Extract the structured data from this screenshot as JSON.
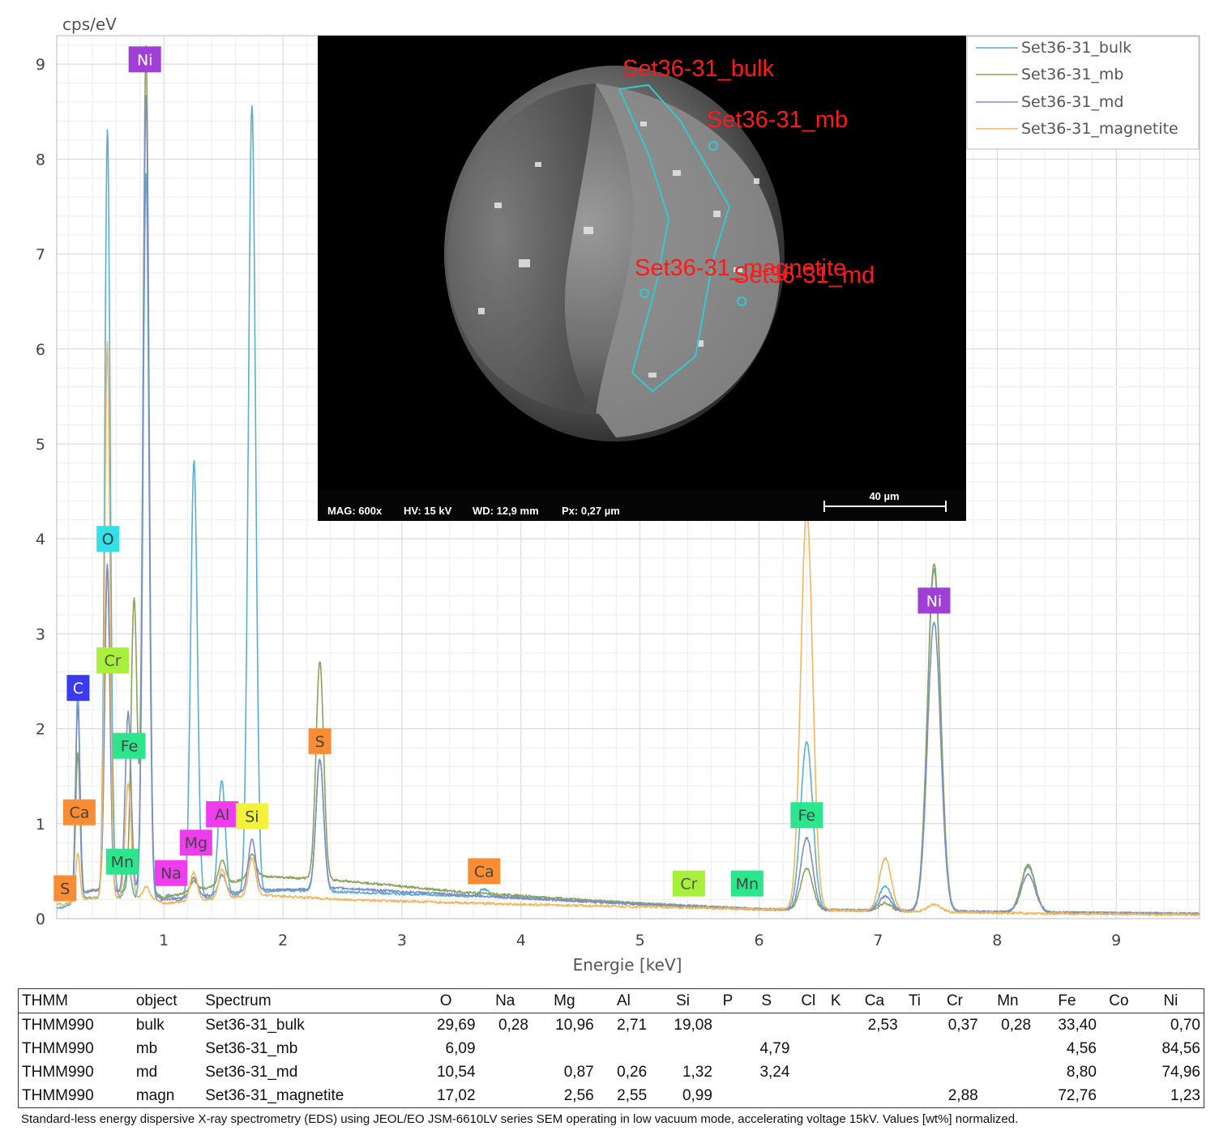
{
  "chart_data": {
    "type": "line",
    "ylabel": "cps/eV",
    "xlabel": "Energie [keV]",
    "xlim": [
      0.1,
      9.7
    ],
    "ylim": [
      0,
      9.3
    ],
    "xticks": [
      1,
      2,
      3,
      4,
      5,
      6,
      7,
      8,
      9
    ],
    "yticks": [
      0,
      1,
      2,
      3,
      4,
      5,
      6,
      7,
      8,
      9
    ],
    "grid": true,
    "legend_position": "top-right",
    "series": [
      {
        "name": "Set36-31_bulk",
        "color": "#5aaed2",
        "baseline": 0.12,
        "continuum": [
          [
            0.15,
            0.12
          ],
          [
            0.35,
            0.22
          ],
          [
            0.9,
            0.2
          ],
          [
            1.0,
            0.17
          ],
          [
            2.0,
            0.3
          ],
          [
            2.5,
            0.28
          ],
          [
            4.0,
            0.22
          ],
          [
            5.0,
            0.16
          ],
          [
            6.0,
            0.1
          ],
          [
            8.0,
            0.07
          ],
          [
            9.7,
            0.05
          ]
        ],
        "peaks": [
          [
            0.277,
            2.2,
            0.018
          ],
          [
            0.525,
            7.88,
            0.022
          ],
          [
            0.56,
            0.6,
            0.025
          ],
          [
            0.7,
            0.35,
            0.025
          ],
          [
            0.85,
            7.65,
            0.025
          ],
          [
            1.04,
            0.08,
            0.03
          ],
          [
            1.253,
            4.62,
            0.028
          ],
          [
            1.486,
            1.22,
            0.03
          ],
          [
            1.74,
            8.3,
            0.03
          ],
          [
            2.31,
            1.4,
            0.032
          ],
          [
            3.69,
            0.08,
            0.04
          ],
          [
            6.4,
            1.77,
            0.05
          ],
          [
            7.06,
            0.26,
            0.05
          ],
          [
            7.47,
            3.6,
            0.055
          ],
          [
            8.26,
            0.48,
            0.058
          ]
        ]
      },
      {
        "name": "Set36-31_mb",
        "color": "#8aa35a",
        "baseline": 0.2,
        "continuum": [
          [
            0.15,
            0.2
          ],
          [
            0.4,
            0.3
          ],
          [
            0.9,
            0.28
          ],
          [
            1.0,
            0.22
          ],
          [
            1.8,
            0.45
          ],
          [
            2.5,
            0.4
          ],
          [
            3.5,
            0.28
          ],
          [
            5.0,
            0.16
          ],
          [
            6.0,
            0.1
          ],
          [
            8.0,
            0.07
          ],
          [
            9.7,
            0.05
          ]
        ],
        "peaks": [
          [
            0.277,
            1.5,
            0.018
          ],
          [
            0.525,
            3.4,
            0.022
          ],
          [
            0.75,
            3.1,
            0.025
          ],
          [
            0.85,
            8.9,
            0.025
          ],
          [
            1.25,
            0.1,
            0.03
          ],
          [
            1.49,
            0.25,
            0.03
          ],
          [
            1.74,
            0.25,
            0.03
          ],
          [
            2.31,
            2.3,
            0.032
          ],
          [
            6.4,
            0.43,
            0.05
          ],
          [
            7.06,
            0.08,
            0.05
          ],
          [
            7.47,
            3.67,
            0.055
          ],
          [
            8.26,
            0.5,
            0.058
          ]
        ]
      },
      {
        "name": "Set36-31_md",
        "color": "#7d8ec7",
        "baseline": 0.2,
        "continuum": [
          [
            0.15,
            0.2
          ],
          [
            0.4,
            0.3
          ],
          [
            0.9,
            0.26
          ],
          [
            1.0,
            0.2
          ],
          [
            1.8,
            0.3
          ],
          [
            2.5,
            0.32
          ],
          [
            3.5,
            0.25
          ],
          [
            5.0,
            0.15
          ],
          [
            6.0,
            0.1
          ],
          [
            8.0,
            0.07
          ],
          [
            9.7,
            0.05
          ]
        ],
        "peaks": [
          [
            0.277,
            2.0,
            0.018
          ],
          [
            0.525,
            3.45,
            0.022
          ],
          [
            0.7,
            1.9,
            0.025
          ],
          [
            0.85,
            8.4,
            0.025
          ],
          [
            1.25,
            0.2,
            0.03
          ],
          [
            1.49,
            0.2,
            0.03
          ],
          [
            1.74,
            0.55,
            0.03
          ],
          [
            2.31,
            1.36,
            0.032
          ],
          [
            6.4,
            0.76,
            0.05
          ],
          [
            7.06,
            0.15,
            0.05
          ],
          [
            7.47,
            3.05,
            0.055
          ],
          [
            8.26,
            0.4,
            0.058
          ]
        ]
      },
      {
        "name": "Set36-31_magnetite",
        "color": "#f2b65e",
        "baseline": 0.15,
        "continuum": [
          [
            0.15,
            0.15
          ],
          [
            0.4,
            0.22
          ],
          [
            0.9,
            0.22
          ],
          [
            1.0,
            0.16
          ],
          [
            1.8,
            0.25
          ],
          [
            2.5,
            0.2
          ],
          [
            4.0,
            0.15
          ],
          [
            6.0,
            0.1
          ],
          [
            8.0,
            0.06
          ],
          [
            9.7,
            0.04
          ]
        ],
        "peaks": [
          [
            0.277,
            0.5,
            0.018
          ],
          [
            0.525,
            5.85,
            0.022
          ],
          [
            0.7,
            1.2,
            0.025
          ],
          [
            0.85,
            0.12,
            0.025
          ],
          [
            1.25,
            0.3,
            0.03
          ],
          [
            1.49,
            0.3,
            0.03
          ],
          [
            1.74,
            0.4,
            0.03
          ],
          [
            6.4,
            4.2,
            0.05
          ],
          [
            7.06,
            0.56,
            0.05
          ],
          [
            7.47,
            0.08,
            0.055
          ]
        ]
      }
    ],
    "element_labels": [
      {
        "text": "Ni",
        "x": 0.84,
        "y": 9.05,
        "color": "#a03fd6",
        "fg": "#ffffff"
      },
      {
        "text": "O",
        "x": 0.53,
        "y": 4.0,
        "color": "#33e0e6",
        "fg": "#333333"
      },
      {
        "text": "Cr",
        "x": 0.57,
        "y": 2.72,
        "color": "#a9f03c",
        "fg": "#555555"
      },
      {
        "text": "C",
        "x": 0.28,
        "y": 2.43,
        "color": "#3a3aee",
        "fg": "#ffffff"
      },
      {
        "text": "Fe",
        "x": 0.71,
        "y": 1.82,
        "color": "#2ce68e",
        "fg": "#444444"
      },
      {
        "text": "Ca",
        "x": 0.29,
        "y": 1.12,
        "color": "#fa8c34",
        "fg": "#444444"
      },
      {
        "text": "Mn",
        "x": 0.65,
        "y": 0.6,
        "color": "#2ce68e",
        "fg": "#444444"
      },
      {
        "text": "Na",
        "x": 1.06,
        "y": 0.48,
        "color": "#ee3cee",
        "fg": "#444444"
      },
      {
        "text": "Mg",
        "x": 1.27,
        "y": 0.8,
        "color": "#ee3cee",
        "fg": "#444444"
      },
      {
        "text": "Al",
        "x": 1.49,
        "y": 1.1,
        "color": "#ee3cee",
        "fg": "#444444"
      },
      {
        "text": "Si",
        "x": 1.74,
        "y": 1.08,
        "color": "#f2f23a",
        "fg": "#444444"
      },
      {
        "text": "S",
        "x": 0.17,
        "y": 0.32,
        "color": "#fa8c34",
        "fg": "#444444"
      },
      {
        "text": "S",
        "x": 2.31,
        "y": 1.87,
        "color": "#fa8c34",
        "fg": "#444444"
      },
      {
        "text": "Ca",
        "x": 3.69,
        "y": 0.5,
        "color": "#fa8c34",
        "fg": "#444444"
      },
      {
        "text": "Cr",
        "x": 5.41,
        "y": 0.37,
        "color": "#a9f03c",
        "fg": "#555555"
      },
      {
        "text": "Mn",
        "x": 5.9,
        "y": 0.37,
        "color": "#2ce68e",
        "fg": "#444444"
      },
      {
        "text": "Fe",
        "x": 6.4,
        "y": 1.09,
        "color": "#2ce68e",
        "fg": "#444444"
      },
      {
        "text": "Ni",
        "x": 7.47,
        "y": 3.35,
        "color": "#a03fd6",
        "fg": "#ffffff"
      }
    ]
  },
  "sem_image": {
    "spot_labels": [
      "Set36-31_bulk",
      "Set36-31_mb",
      "Set36-31_magnetite",
      "Set36-31_md"
    ],
    "info": {
      "mag": "MAG: 600x",
      "hv": "HV: 15 kV",
      "wd": "WD: 12,9 mm",
      "px": "Px: 0,27 µm"
    },
    "scale_bar": "40 µm"
  },
  "table": {
    "headers": [
      "THMM",
      "object",
      "Spectrum",
      "O",
      "Na",
      "Mg",
      "Al",
      "Si",
      "P",
      "S",
      "Cl",
      "K",
      "Ca",
      "Ti",
      "Cr",
      "Mn",
      "Fe",
      "Co",
      "Ni"
    ],
    "rows": [
      [
        "THMM990",
        "bulk",
        "Set36-31_bulk",
        "29,69",
        "0,28",
        "10,96",
        "2,71",
        "19,08",
        "",
        "",
        "",
        "",
        "2,53",
        "",
        "0,37",
        "0,28",
        "33,40",
        "",
        "0,70"
      ],
      [
        "THMM990",
        "mb",
        "Set36-31_mb",
        "6,09",
        "",
        "",
        "",
        "",
        "",
        "4,79",
        "",
        "",
        "",
        "",
        "",
        "",
        "4,56",
        "",
        "84,56"
      ],
      [
        "THMM990",
        "md",
        "Set36-31_md",
        "10,54",
        "",
        "0,87",
        "0,26",
        "1,32",
        "",
        "3,24",
        "",
        "",
        "",
        "",
        "",
        "",
        "8,80",
        "",
        "74,96"
      ],
      [
        "THMM990",
        "magn",
        "Set36-31_magnetite",
        "17,02",
        "",
        "2,56",
        "2,55",
        "0,99",
        "",
        "",
        "",
        "",
        "",
        "",
        "2,88",
        "",
        "72,76",
        "",
        "1,23"
      ]
    ]
  },
  "footnote": "Standard-less energy dispersive X-ray spectrometry (EDS) using JEOL/EO JSM-6610LV series SEM operating in low vacuum mode, accelerating voltage 15kV. Values [wt%] normalized."
}
